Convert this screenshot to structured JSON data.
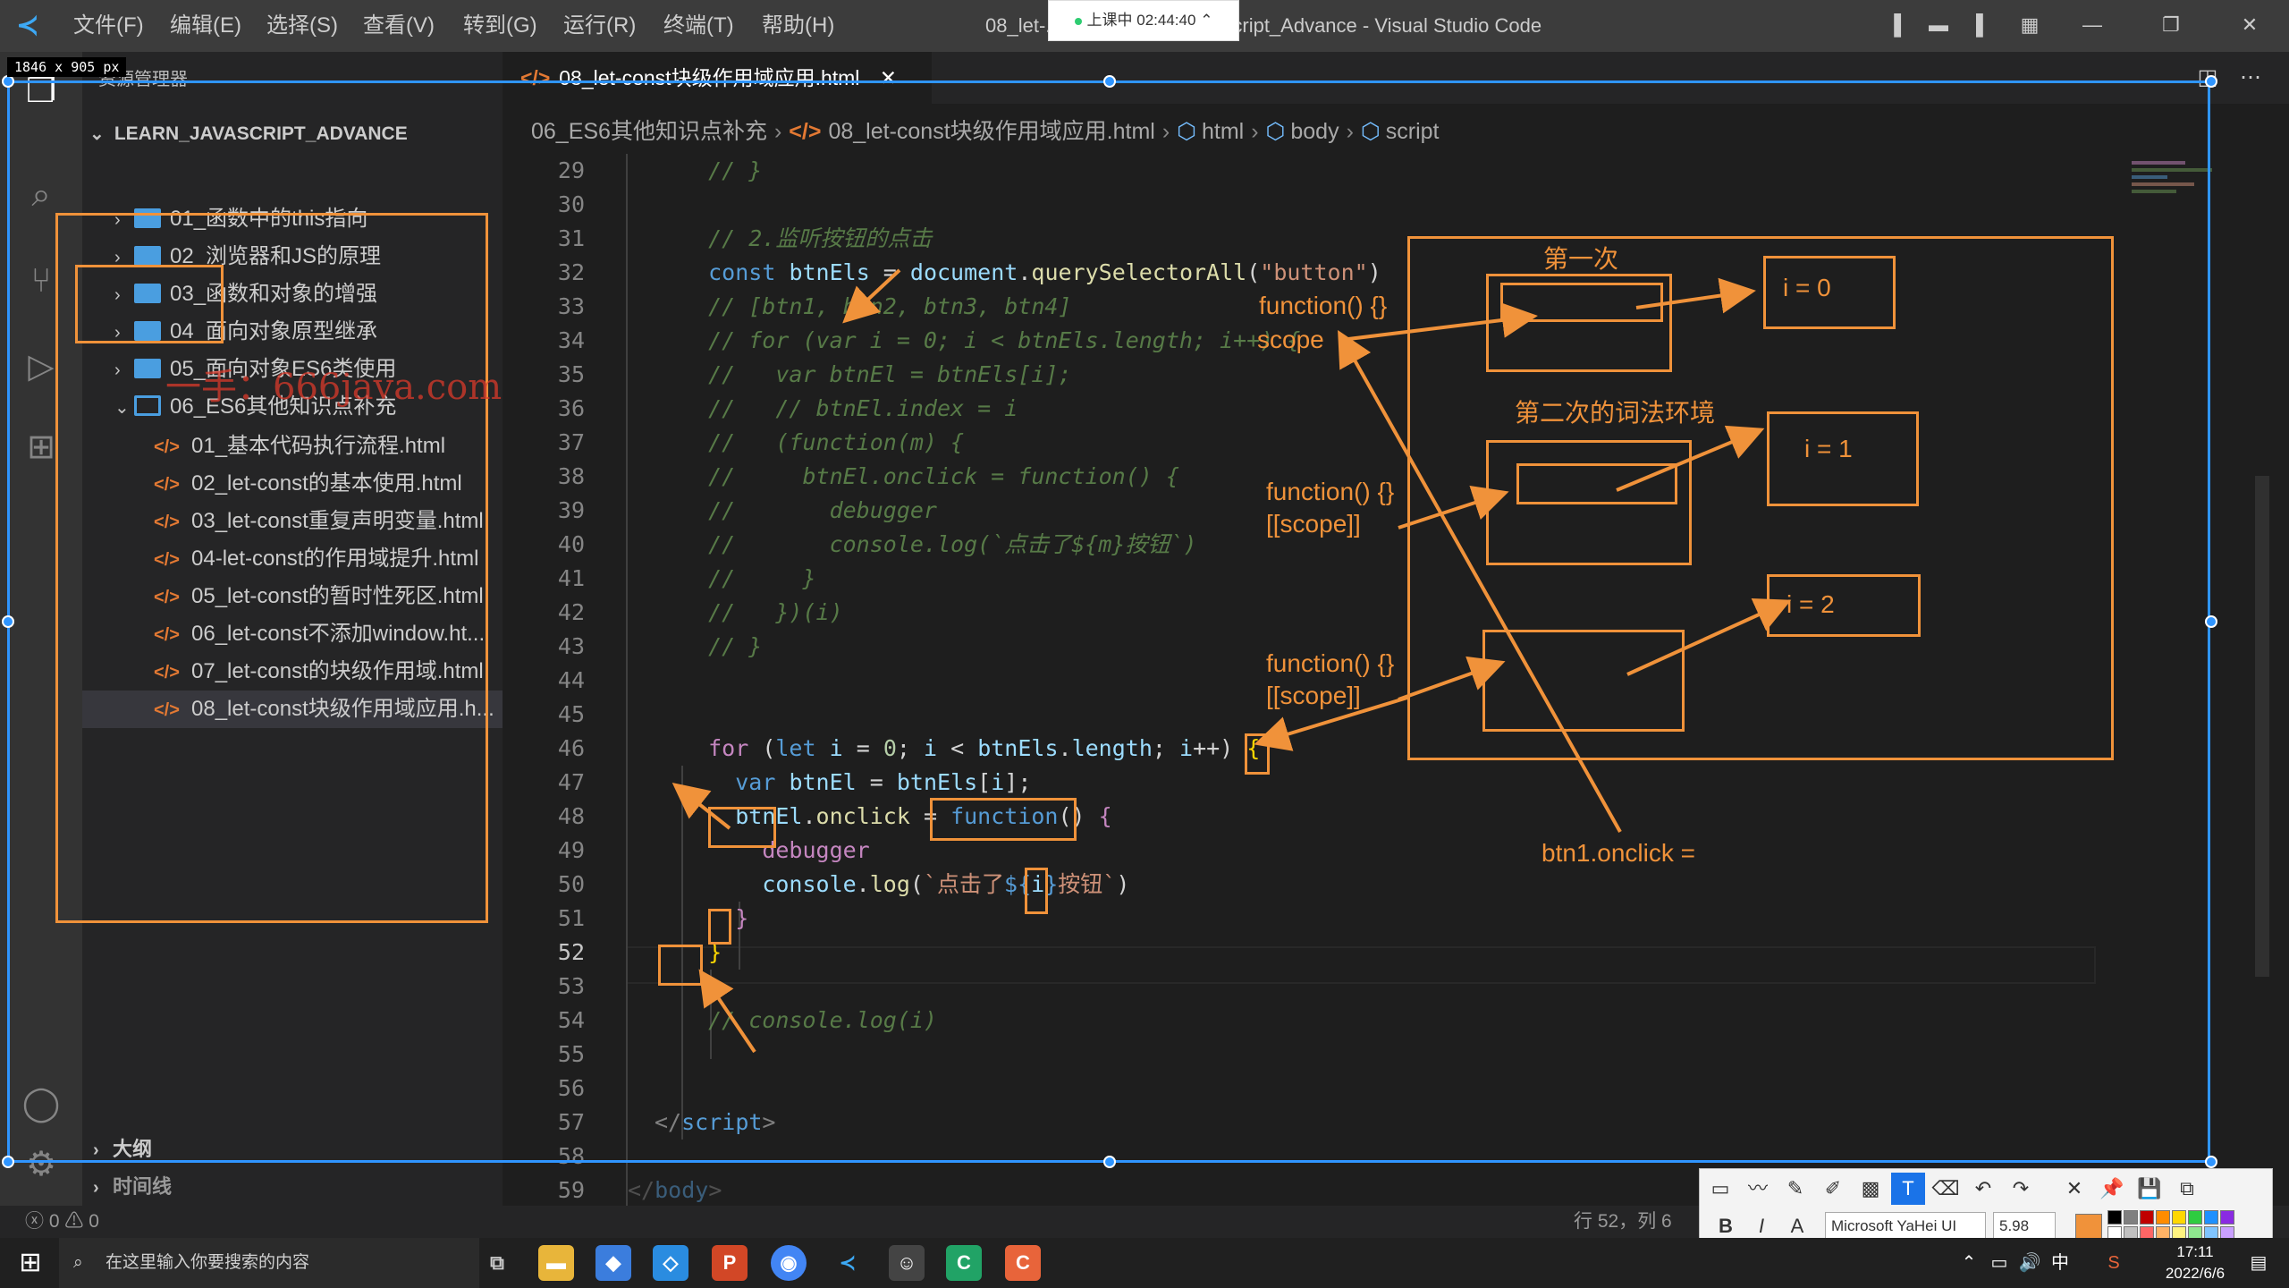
{
  "menu": [
    "文件(F)",
    "编辑(E)",
    "选择(S)",
    "查看(V)",
    "转到(G)",
    "运行(R)",
    "终端(T)",
    "帮助(H)"
  ],
  "window_title": "08_let-...html - Learn_JavaScript_Advance - Visual Studio Code",
  "live_badge": "上课中 02:44:40",
  "size_label": "1846 x 905  px",
  "sidebar": {
    "heading": "资源管理器",
    "workspace": "LEARN_JAVASCRIPT_ADVANCE",
    "folders": [
      "01_函数中的this指向",
      "02_浏览器和JS的原理",
      "03_函数和对象的增强",
      "04_面向对象原型继承",
      "05_面向对象ES6类使用",
      "06_ES6其他知识点补充"
    ],
    "files": [
      "01_基本代码执行流程.html",
      "02_let-const的基本使用.html",
      "03_let-const重复声明变量.html",
      "04-let-const的作用域提升.html",
      "05_let-const的暂时性死区.html",
      "06_let-const不添加window.ht...",
      "07_let-const的块级作用域.html",
      "08_let-const块级作用域应用.h..."
    ],
    "outline": "大纲",
    "timeline": "时间线"
  },
  "tab": {
    "label": "08_let-const块级作用域应用.html",
    "close": "✕"
  },
  "breadcrumbs": [
    "06_ES6其他知识点补充",
    "08_let-const块级作用域应用.html",
    "html",
    "body",
    "script"
  ],
  "editor": {
    "line_numbers": [
      "29",
      "30",
      "31",
      "32",
      "33",
      "34",
      "35",
      "36",
      "37",
      "38",
      "39",
      "40",
      "41",
      "42",
      "43",
      "44",
      "45",
      "46",
      "47",
      "48",
      "49",
      "50",
      "51",
      "52",
      "53",
      "54",
      "55",
      "56",
      "57",
      "58",
      "59"
    ],
    "current_line": "52"
  },
  "annotations": {
    "first": "第一次",
    "second_env": "第二次的词法环境",
    "i0": "i = 0",
    "i1": "i = 1",
    "i2": "i = 2",
    "fn1": "function() {}",
    "scope1": "scope",
    "fn2": "function() {}",
    "scope2": "[[scope]]",
    "fn3": "function() {}",
    "scope3": "[[scope]]",
    "btn_onclick": "btn1.onclick ="
  },
  "watermark": "一手：666java.com",
  "status": {
    "errors": "0",
    "warnings": "0",
    "cursor": "行 52，列 6"
  },
  "draw_toolbar": {
    "font": "Microsoft YaHei UI",
    "size": "5.98",
    "bold": "B",
    "italic": "I",
    "text_tool": "T"
  },
  "taskbar": {
    "search_placeholder": "在这里输入你要搜索的内容",
    "time": "17:11",
    "date": "2022/6/6"
  },
  "colors": {
    "accent": "#f0923a",
    "selection": "#2f95ff",
    "titlebar": "#3c3c3c"
  }
}
